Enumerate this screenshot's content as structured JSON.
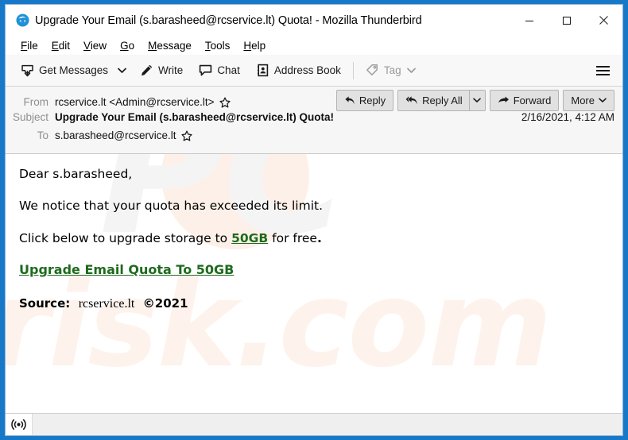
{
  "window": {
    "title": "Upgrade Your Email (s.barasheed@rcservice.lt) Quota! - Mozilla Thunderbird",
    "app_icon": "thunderbird-icon",
    "minimize_label": "─",
    "maximize_label": "□",
    "close_label": "✕",
    "border_color": "#1878c8"
  },
  "menubar": {
    "items": [
      {
        "label": "File",
        "accel": "F",
        "rest": "ile"
      },
      {
        "label": "Edit",
        "accel": "E",
        "rest": "dit"
      },
      {
        "label": "View",
        "accel": "V",
        "rest": "iew"
      },
      {
        "label": "Go",
        "accel": "G",
        "rest": "o"
      },
      {
        "label": "Message",
        "accel": "M",
        "rest": "essage"
      },
      {
        "label": "Tools",
        "accel": "T",
        "rest": "ools"
      },
      {
        "label": "Help",
        "accel": "H",
        "rest": "elp"
      }
    ]
  },
  "toolbar": {
    "get_messages_label": "Get Messages",
    "get_messages_icon": "download-inbox-icon",
    "get_messages_caret": "⌄",
    "write_label": "Write",
    "write_icon": "pencil-icon",
    "chat_label": "Chat",
    "chat_icon": "chat-bubble-icon",
    "address_book_label": "Address Book",
    "address_book_icon": "address-book-icon",
    "tag_label": "Tag",
    "tag_icon": "tag-icon",
    "tag_caret": "⌄",
    "tag_disabled": true,
    "app_menu_icon": "hamburger-menu-icon"
  },
  "message_header": {
    "from_label": "From",
    "from_value": "rcservice.lt <Admin@rcservice.lt>",
    "subject_label": "Subject",
    "subject_value": "Upgrade Your Email (s.barasheed@rcservice.lt) Quota!",
    "to_label": "To",
    "to_value": "s.barasheed@rcservice.lt",
    "date": "2/16/2021, 4:12 AM",
    "star_icon": "star-outline-icon",
    "actions": {
      "reply_label": "Reply",
      "reply_icon": "reply-arrow-icon",
      "reply_all_label": "Reply All",
      "reply_all_icon": "reply-all-arrow-icon",
      "reply_all_caret": "⌄",
      "forward_label": "Forward",
      "forward_icon": "forward-arrow-icon",
      "more_label": "More",
      "more_caret": "⌄"
    }
  },
  "email_body": {
    "greeting": "Dear s.barasheed,",
    "line_notice": "We notice that your quota has exceeded its limit.",
    "line_click_prefix": "Click below to upgrade storage to ",
    "line_click_highlight": "50GB",
    "line_click_suffix": " for free",
    "line_click_period": ".",
    "cta_link": "Upgrade Email Quota To 50GB",
    "source_label": "Source:",
    "source_domain": "rcservice.lt",
    "source_copyright": "©2021",
    "link_color": "#1e6b1e"
  },
  "watermark": {
    "top_text": "PC",
    "bottom_text": "risk.com"
  },
  "statusbar": {
    "connection_icon": "broadcast-online-icon",
    "status_text": ""
  }
}
